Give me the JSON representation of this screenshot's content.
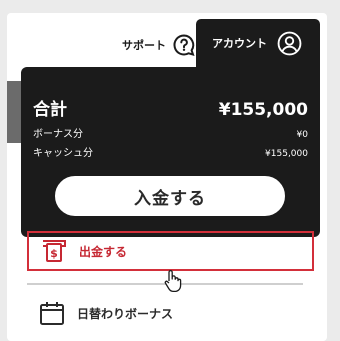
{
  "header": {
    "support_label": "サポート",
    "account_label": "アカウント"
  },
  "balance": {
    "total_label": "合計",
    "total_value": "¥155,000",
    "bonus_label": "ボーナス分",
    "bonus_value": "¥0",
    "cash_label": "キャッシュ分",
    "cash_value": "¥155,000"
  },
  "deposit_button": "入金する",
  "menu": {
    "withdraw_label": "出金する",
    "daily_bonus_label": "日替わりボーナス"
  },
  "colors": {
    "dark": "#1b1b1b",
    "accent_red": "#d32f3a",
    "panel_bg": "#ffffff",
    "page_bg": "#ebebeb"
  }
}
